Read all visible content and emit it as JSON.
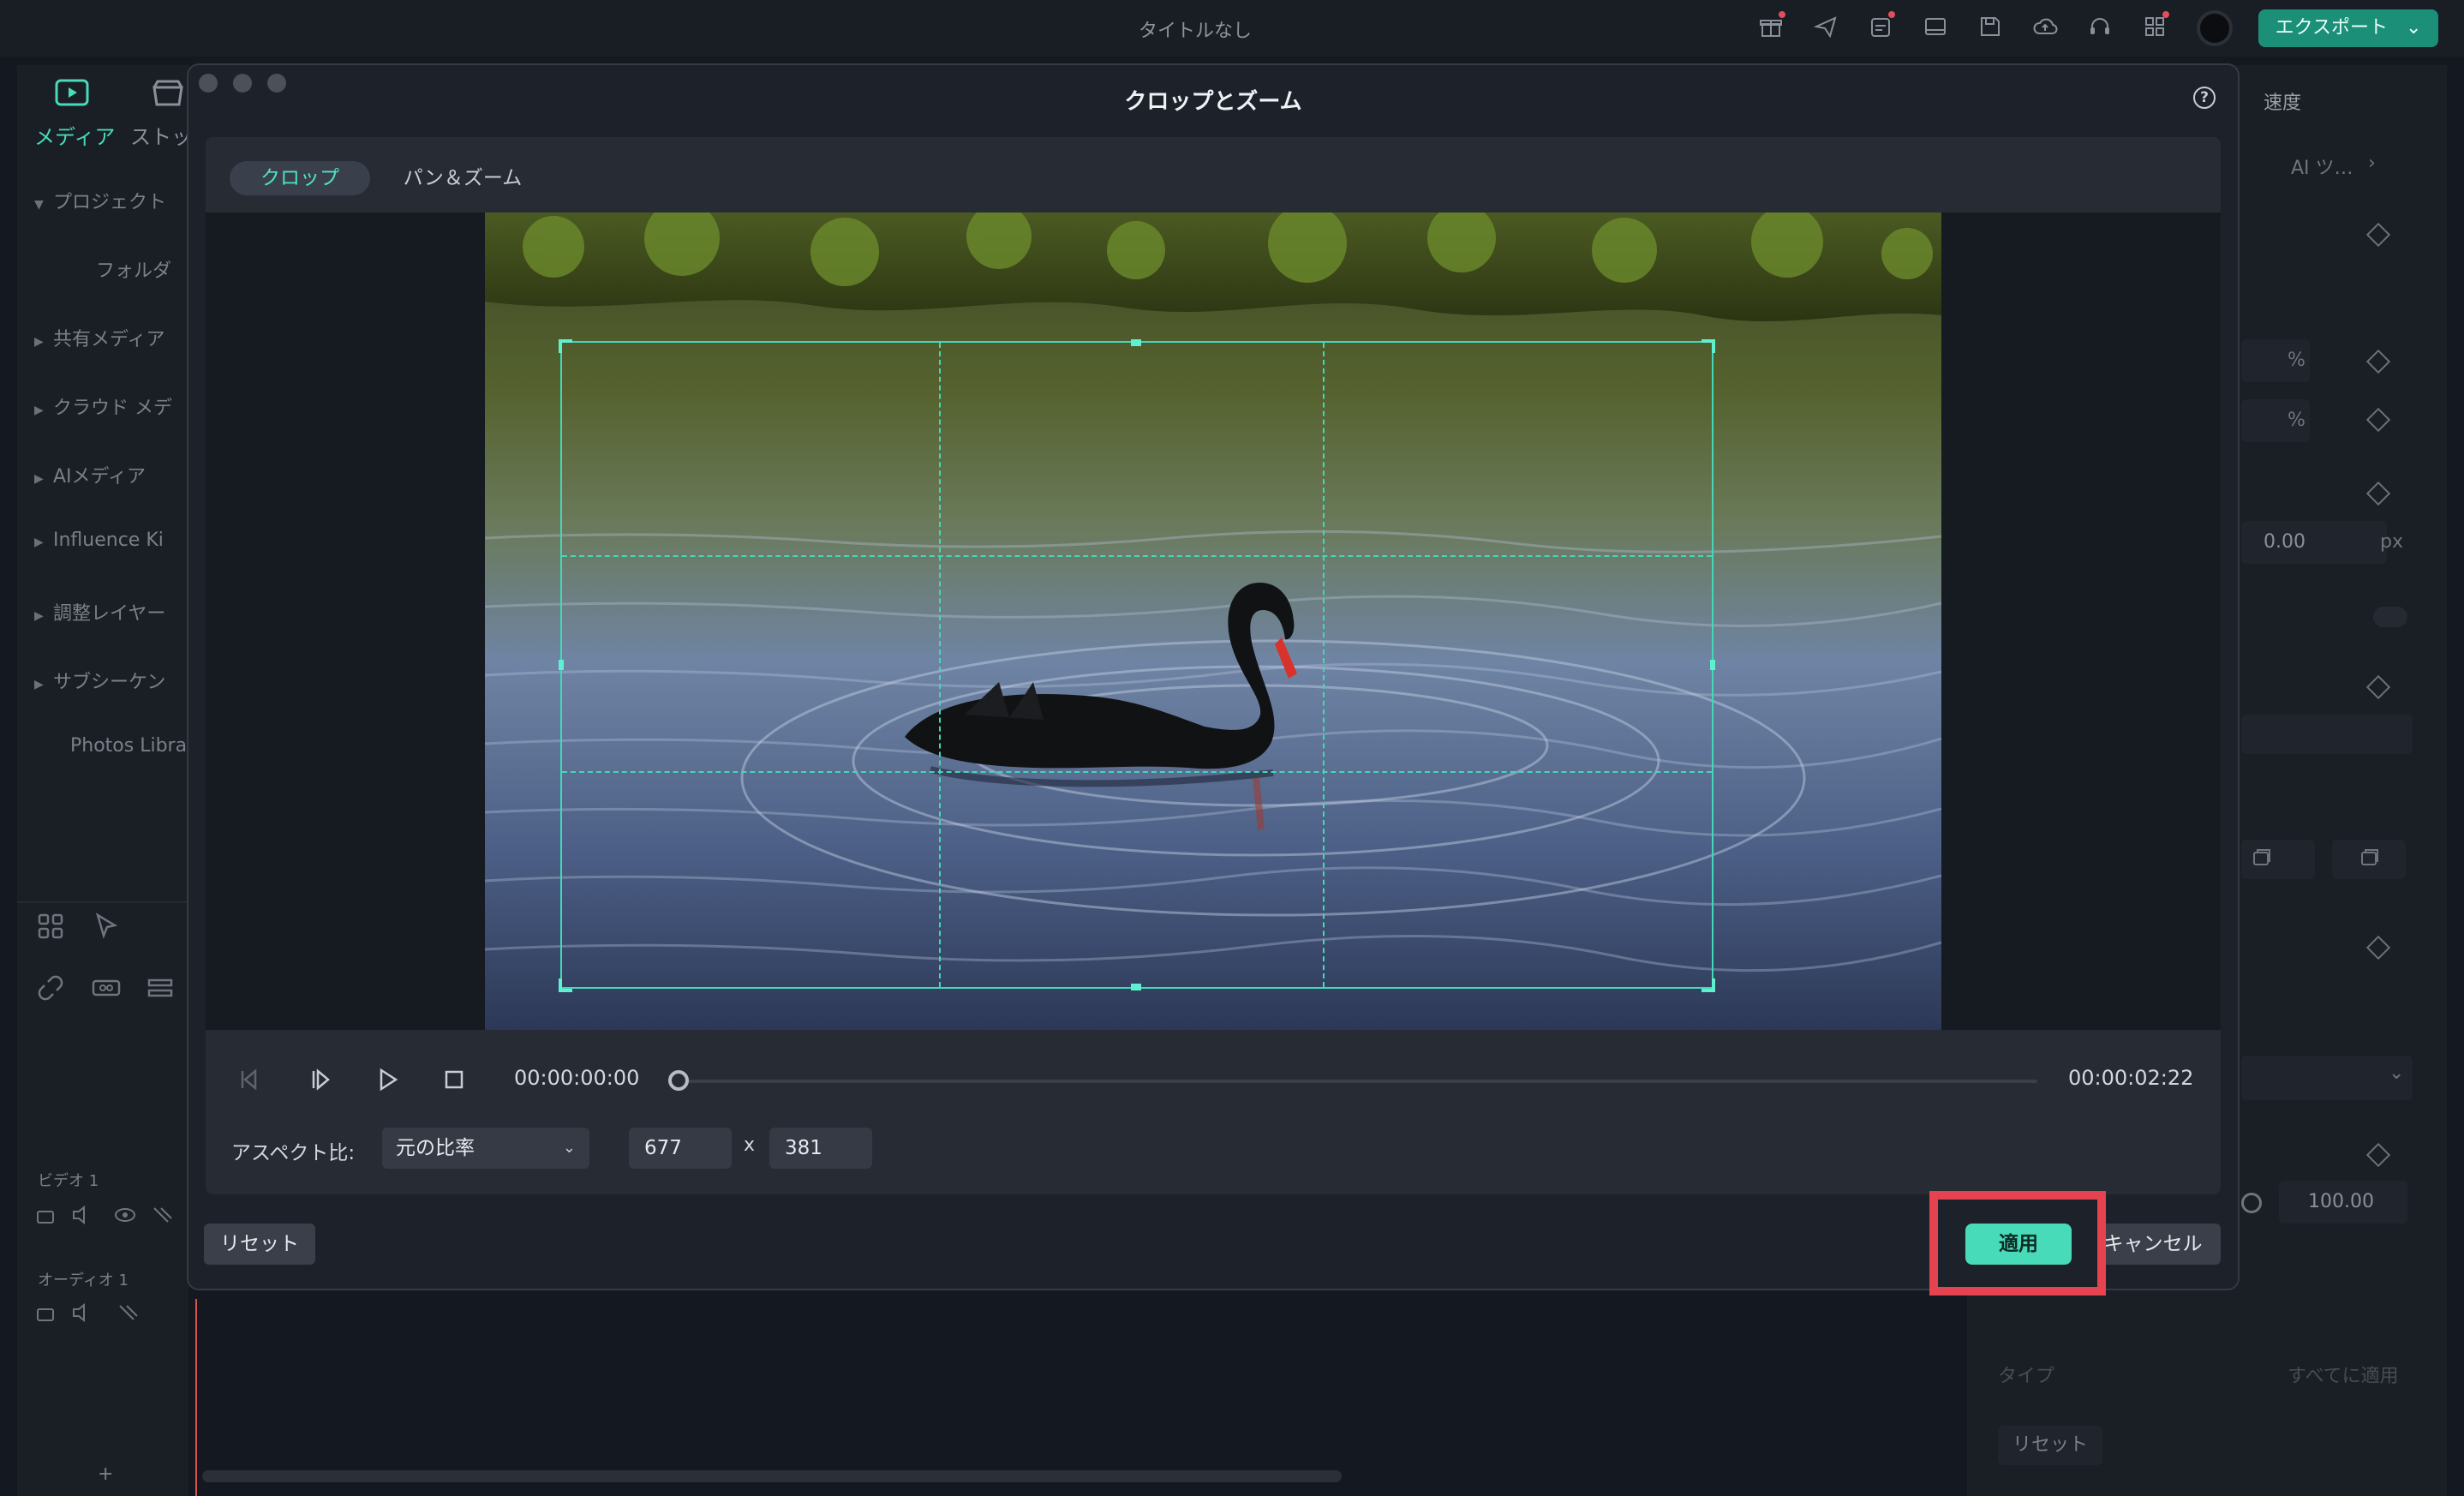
{
  "app": {
    "title": "タイトルなし",
    "export_label": "エクスポート",
    "export_chevron": "⌄"
  },
  "left_panel": {
    "tabs": [
      "メディア",
      "ストッ"
    ],
    "items": [
      {
        "label": "プロジェクト",
        "expanded": true
      },
      {
        "label": "フォルダ"
      },
      {
        "label": "共有メディア"
      },
      {
        "label": "クラウド メデ"
      },
      {
        "label": "AIメディア"
      },
      {
        "label": "Influence Ki"
      },
      {
        "label": "調整レイヤー"
      },
      {
        "label": "サブシーケン"
      },
      {
        "label": "Photos Libra"
      }
    ],
    "tracks": {
      "video": "ビデオ 1",
      "audio": "オーディオ 1"
    },
    "add": "+"
  },
  "right_panel": {
    "tab_speed": "速度",
    "ai_tools": "AI ツ…",
    "pct1": "%",
    "pct2": "%",
    "value_px": "0.00",
    "unit_px": "px",
    "value_100": "100.00",
    "type_label": "タイプ",
    "apply_all": "すべてに適用",
    "reset": "リセット"
  },
  "dialog": {
    "title": "クロップとズーム",
    "help": "?",
    "tabs": [
      {
        "label": "クロップ",
        "active": true
      },
      {
        "label": "パン＆ズーム",
        "active": false
      }
    ],
    "time_current": "00:00:00:00",
    "time_end": "00:00:02:22",
    "scrub_progress": 0.0,
    "aspect_label": "アスペクト比:",
    "aspect_value": "元の比率",
    "width": "677",
    "times": "x",
    "height": "381",
    "reset_label": "リセット",
    "apply_label": "適用",
    "cancel_label": "キャンセル"
  },
  "colors": {
    "accent": "#47dbb9",
    "highlight": "#e5434f",
    "crop_line": "#42d8b8"
  }
}
